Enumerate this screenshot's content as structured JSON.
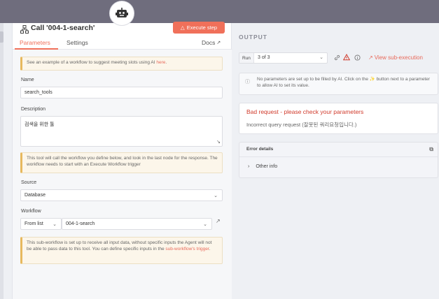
{
  "node": {
    "title": "Call '004-1-search'",
    "execute_label": "Execute step"
  },
  "tabs": {
    "parameters": "Parameters",
    "settings": "Settings",
    "docs": "Docs"
  },
  "notices": {
    "example_prefix": "See an example of a workflow to suggest meeting slots using AI ",
    "example_link": "here",
    "example_suffix": ".",
    "tool_info": "This tool will call the workflow you define below, and look in the last node for the response. The workflow needs to start with an Execute Workflow trigger",
    "subworkflow_info_prefix": "This sub-workflow is set up to receive all input data, without specific inputs the Agent will not be able to pass data to this tool. You can define specific inputs in the ",
    "subworkflow_info_link": "sub-workflow's trigger",
    "subworkflow_info_suffix": "."
  },
  "fields": {
    "name_label": "Name",
    "name_value": "search_tools",
    "description_label": "Description",
    "description_value": "검색을 위한 툴",
    "source_label": "Source",
    "source_value": "Database",
    "workflow_label": "Workflow",
    "workflow_mode": "From list",
    "workflow_value": "004-1-search"
  },
  "output": {
    "title": "OUTPUT",
    "run_label": "Run",
    "run_value": "3 of 3",
    "view_sub_execution": "View sub-execution",
    "no_params_text": "No parameters are set up to be filled by AI. Click on the ✨ button next to a parameter to allow AI to set its value.",
    "error_title": "Bad request - please check your parameters",
    "error_subtitle": "Incorrect query request (잘못된 쿼리요청입니다.)",
    "error_details_label": "Error details",
    "other_info_label": "Other info"
  },
  "colors": {
    "accent": "#f0705a",
    "error": "#d03a2b",
    "topbar": "#6f6d7d"
  }
}
